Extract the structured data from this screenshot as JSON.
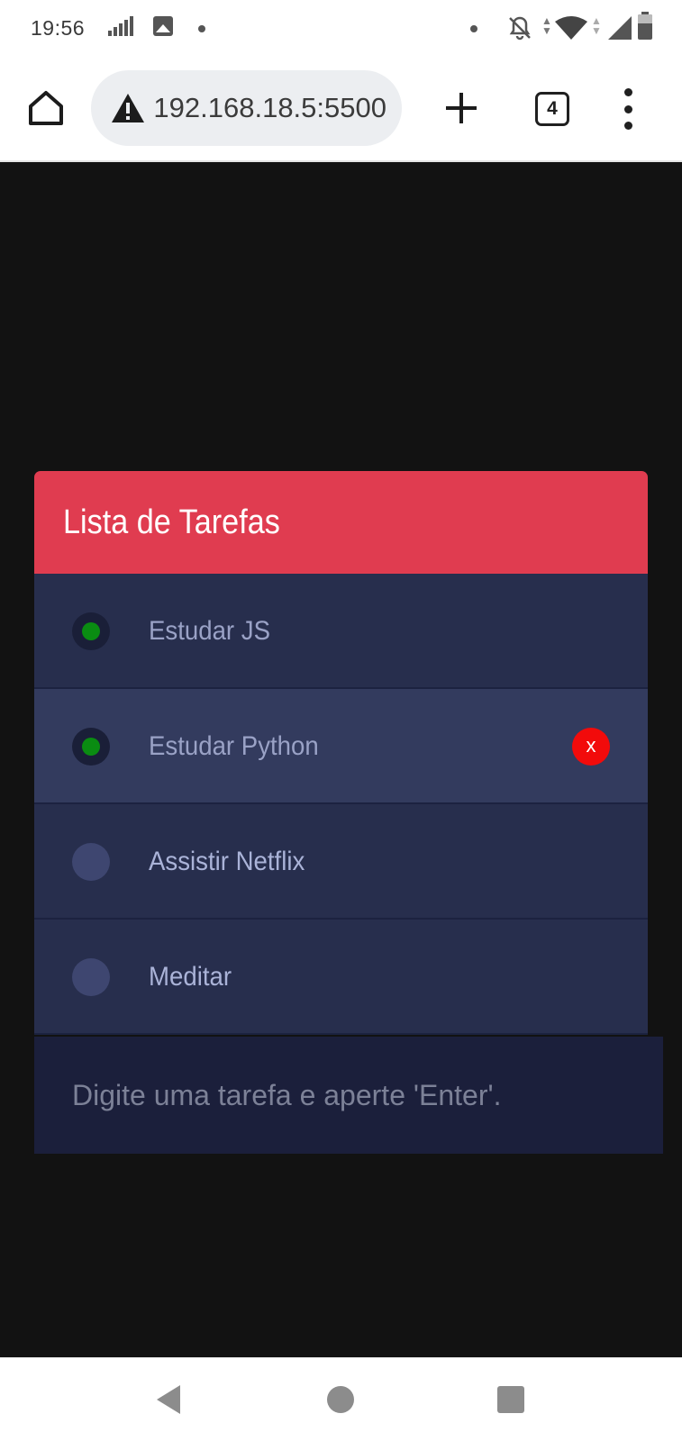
{
  "status_bar": {
    "time": "19:56",
    "icons": [
      "equalizer-icon",
      "gallery-icon",
      "notification-dot-icon",
      "notification-dot-icon",
      "bell-off-icon",
      "data-arrows-icon",
      "wifi-icon",
      "cell-signal-icon",
      "battery-icon"
    ]
  },
  "browser": {
    "url": "192.168.18.5:5500",
    "security_icon": "warning-triangle-icon",
    "tab_count": "4"
  },
  "app": {
    "title": "Lista de Tarefas",
    "accent_color": "#e03c50",
    "tasks": [
      {
        "label": "Estudar JS",
        "done": true
      },
      {
        "label": "Estudar Python",
        "done": true,
        "delete_label": "x"
      },
      {
        "label": "Assistir Netflix",
        "done": false
      },
      {
        "label": "Meditar",
        "done": false
      }
    ],
    "input_placeholder": "Digite uma tarefa e aperte 'Enter'."
  },
  "nav_bar": {
    "buttons": [
      "back-icon",
      "home-icon",
      "recents-icon"
    ]
  }
}
